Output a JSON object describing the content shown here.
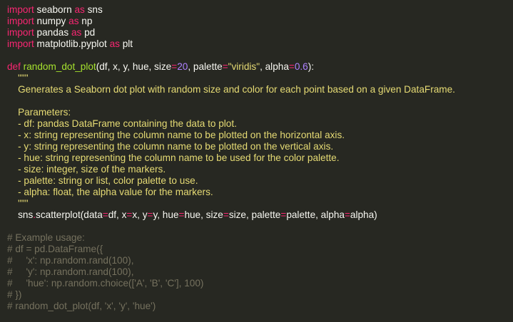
{
  "colors": {
    "background": "#272822",
    "keyword": "#f92672",
    "function_name": "#a6e22e",
    "number": "#ae81ff",
    "string": "#e6db74",
    "comment": "#75715e",
    "text": "#f8f8f2"
  },
  "code": {
    "imports": [
      {
        "kw": "import",
        "module": " seaborn ",
        "as": "as",
        "alias": " sns"
      },
      {
        "kw": "import",
        "module": " numpy ",
        "as": "as",
        "alias": " np"
      },
      {
        "kw": "import",
        "module": " pandas ",
        "as": "as",
        "alias": " pd"
      },
      {
        "kw": "import",
        "module": " matplotlib.pyplot ",
        "as": "as",
        "alias": " plt"
      }
    ],
    "def_line": {
      "kw": "def",
      "name": " random_dot_plot",
      "params_start": "(df, x, y, hue, size",
      "eq1": "=",
      "size_default": "20",
      "palette_part": ", palette",
      "eq2": "=",
      "palette_default": "\"viridis\"",
      "alpha_part": ", alpha",
      "eq3": "=",
      "alpha_default": "0.6",
      "end": "):"
    },
    "docstring": [
      "    \"\"\"",
      "    Generates a Seaborn dot plot with random size and color for each point based on a given DataFrame.",
      "",
      "    Parameters:",
      "    - df: pandas DataFrame containing the data to plot.",
      "    - x: string representing the column name to be plotted on the horizontal axis.",
      "    - y: string representing the column name to be plotted on the vertical axis.",
      "    - hue: string representing the column name to be used for the color palette.",
      "    - size: integer, size of the markers.",
      "    - palette: string or list, color palette to use.",
      "    - alpha: float, the alpha value for the markers.",
      "    \"\"\""
    ],
    "call_line": {
      "indent": "    ",
      "obj": "sns",
      "dot": ".",
      "method": "scatterplot",
      "p1": "(data",
      "e1": "=",
      "p2": "df, x",
      "e2": "=",
      "p3": "x, y",
      "e3": "=",
      "p4": "y, hue",
      "e4": "=",
      "p5": "hue, size",
      "e5": "=",
      "p6": "size, palette",
      "e6": "=",
      "p7": "palette, alpha",
      "e7": "=",
      "p8": "alpha)"
    },
    "comments": [
      "# Example usage:",
      "# df = pd.DataFrame({",
      "#     'x': np.random.rand(100),",
      "#     'y': np.random.rand(100),",
      "#     'hue': np.random.choice(['A', 'B', 'C'], 100)",
      "# })",
      "# random_dot_plot(df, 'x', 'y', 'hue')"
    ]
  }
}
